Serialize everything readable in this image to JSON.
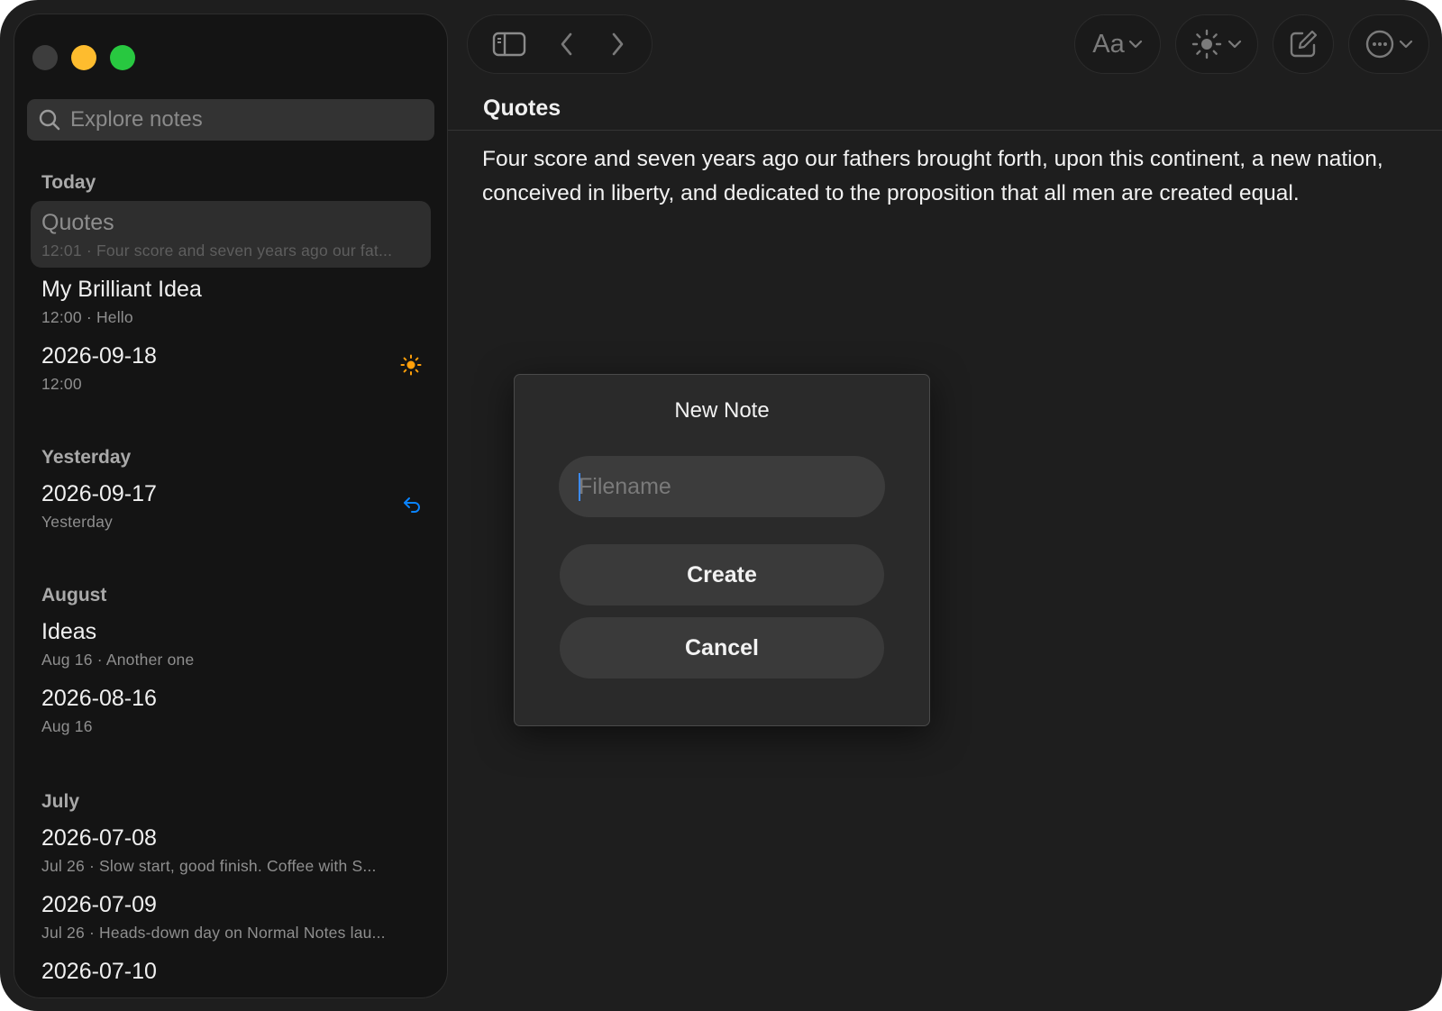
{
  "search": {
    "placeholder": "Explore notes"
  },
  "sidebar": {
    "sections": [
      {
        "header": "Today",
        "notes": [
          {
            "title": "Quotes",
            "subtitle": "12:01 · Four score and seven years ago our fat...",
            "selected": true
          },
          {
            "title": "My Brilliant Idea",
            "subtitle": "12:00 · Hello"
          },
          {
            "title": "2026-09-18",
            "subtitle": "12:00",
            "icon": "sun-icon",
            "icon_color": "#ff9f0a"
          }
        ]
      },
      {
        "header": "Yesterday",
        "notes": [
          {
            "title": "2026-09-17",
            "subtitle": "Yesterday",
            "icon": "undo-arrow-icon",
            "icon_color": "#0a84ff"
          }
        ]
      },
      {
        "header": "August",
        "notes": [
          {
            "title": "Ideas",
            "subtitle": "Aug 16 · Another one"
          },
          {
            "title": "2026-08-16",
            "subtitle": "Aug 16"
          }
        ]
      },
      {
        "header": "July",
        "notes": [
          {
            "title": "2026-07-08",
            "subtitle": "Jul 26 · Slow start, good finish. Coffee with S..."
          },
          {
            "title": "2026-07-09",
            "subtitle": "Jul 26 · Heads-down day on Normal Notes lau..."
          },
          {
            "title": "2026-07-10",
            "subtitle": ""
          }
        ]
      }
    ]
  },
  "toolbar": {
    "sidebar_toggle_icon": "sidebar-toggle-icon",
    "back_icon": "chevron-left-icon",
    "forward_icon": "chevron-right-icon",
    "font_label": "Aa",
    "theme_icon": "sun-icon",
    "compose_icon": "compose-icon",
    "more_icon": "ellipsis-circle-icon"
  },
  "note": {
    "title": "Quotes",
    "body": "Four score and seven years ago our fathers brought forth, upon this continent, a new nation, conceived in liberty, and dedicated to the proposition that all men are created equal."
  },
  "dialog": {
    "title": "New Note",
    "filename_placeholder": "Filename",
    "filename_value": "",
    "create_label": "Create",
    "cancel_label": "Cancel"
  },
  "colors": {
    "window_bg": "#1e1e1e",
    "sidebar_bg": "#141414",
    "accent_blue": "#0a84ff",
    "accent_orange": "#ff9f0a",
    "traffic_red_inactive": "#3d3d3d",
    "traffic_yellow": "#febc2e",
    "traffic_green": "#28c840"
  }
}
